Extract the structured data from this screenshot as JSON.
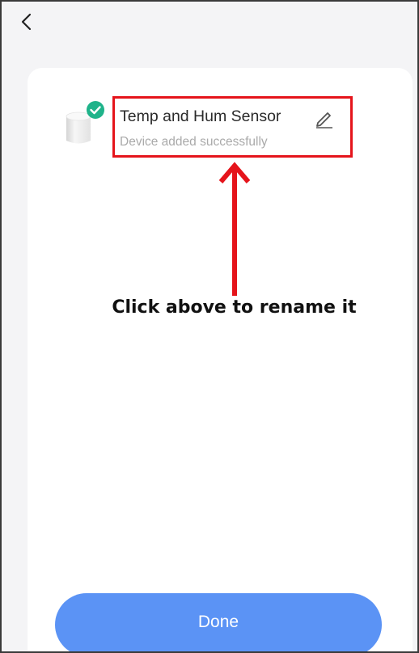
{
  "header": {
    "back_icon": "chevron-left-icon"
  },
  "device": {
    "name": "Temp and Hum Sensor",
    "status": "Device added successfully",
    "icon": "sensor-device-icon",
    "badge_icon": "check-circle-icon",
    "edit_icon": "pencil-icon"
  },
  "annotation": {
    "text": "Click above to rename it",
    "color": "#e5141b"
  },
  "footer": {
    "done_label": "Done"
  },
  "colors": {
    "accent": "#5b93f5",
    "success": "#1fb38a",
    "highlight": "#e5141b"
  }
}
